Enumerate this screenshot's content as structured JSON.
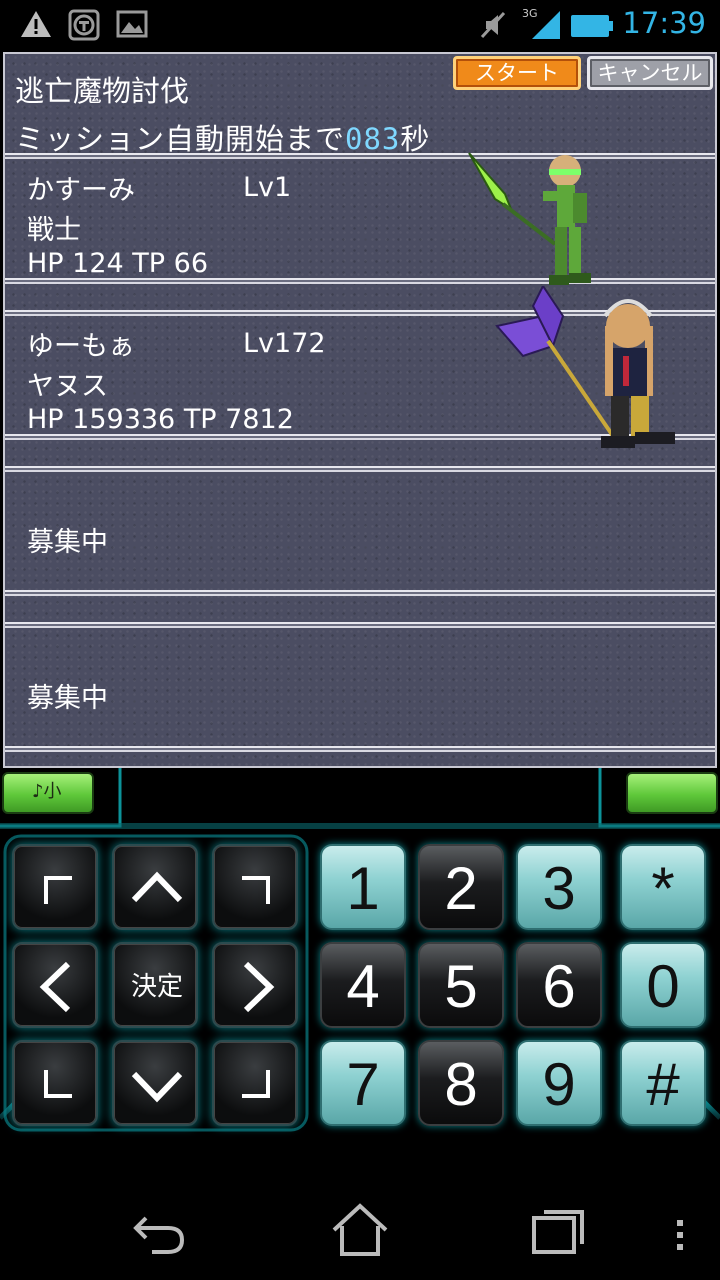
{
  "status_bar": {
    "time": "17:39",
    "network": "3G",
    "icons": [
      "warning-icon",
      "shield-app-icon",
      "gallery-icon",
      "mute-icon",
      "signal-icon",
      "battery-icon"
    ]
  },
  "mission": {
    "title": "逃亡魔物討伐",
    "autostart_prefix": "ミッション自動開始まで",
    "autostart_count": "083",
    "autostart_suffix": "秒",
    "start_label": "スタート",
    "cancel_label": "キャンセル"
  },
  "party": [
    {
      "name": "かすーみ",
      "level": "Lv1",
      "job": "戦士",
      "stats": "HP 124  TP 66"
    },
    {
      "name": "ゆーもぁ",
      "level": "Lv172",
      "job": "ヤヌス",
      "stats": "HP 159336  TP 7812"
    },
    {
      "recruit": "募集中"
    },
    {
      "recruit": "募集中"
    }
  ],
  "controller": {
    "volume_label": "♪小",
    "center_label": "決定",
    "keys": [
      {
        "label": "1",
        "style": "teal"
      },
      {
        "label": "2",
        "style": "dark"
      },
      {
        "label": "3",
        "style": "teal"
      },
      {
        "label": "*",
        "style": "teal"
      },
      {
        "label": "4",
        "style": "dark"
      },
      {
        "label": "5",
        "style": "dark"
      },
      {
        "label": "6",
        "style": "dark"
      },
      {
        "label": "0",
        "style": "teal"
      },
      {
        "label": "7",
        "style": "teal"
      },
      {
        "label": "8",
        "style": "dark"
      },
      {
        "label": "9",
        "style": "teal"
      },
      {
        "label": "#",
        "style": "teal"
      }
    ]
  },
  "colors": {
    "accent_blue": "#33b5e5",
    "game_bg": "#4b4d62",
    "start_orange": "#f08a1a",
    "glow_cyan": "#0a7f86"
  }
}
